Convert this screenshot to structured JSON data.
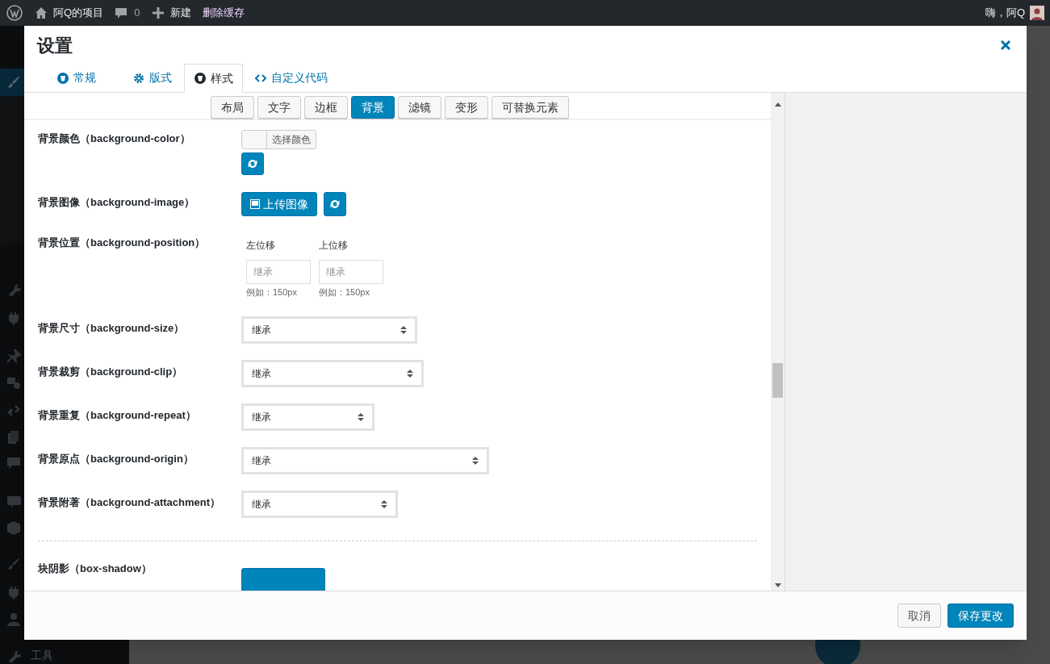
{
  "admin_bar": {
    "site": "阿Q的项目",
    "comments": "0",
    "new": "新建",
    "purge_cache": "删除缓存",
    "greeting": "嗨，阿Q"
  },
  "sidebar": {
    "items": [
      {
        "label": "工具"
      }
    ]
  },
  "modal": {
    "title": "设置",
    "tabs": [
      {
        "label": "常规",
        "selected": false
      },
      {
        "label": "版式",
        "selected": false
      },
      {
        "label": "样式",
        "selected": true
      },
      {
        "label": "自定义代码",
        "selected": false
      }
    ],
    "subtabs": [
      {
        "label": "布局",
        "selected": false
      },
      {
        "label": "文字",
        "selected": false
      },
      {
        "label": "边框",
        "selected": false
      },
      {
        "label": "背景",
        "selected": true
      },
      {
        "label": "滤镜",
        "selected": false
      },
      {
        "label": "变形",
        "selected": false
      },
      {
        "label": "可替换元素",
        "selected": false
      }
    ],
    "fields": [
      {
        "kind": "color",
        "label": "背景颜色（background-color）",
        "button": "选择颜色"
      },
      {
        "kind": "image",
        "label": "背景图像（background-image）",
        "button": "上传图像"
      },
      {
        "kind": "position",
        "label": "背景位置（background-position）",
        "inputs": [
          {
            "label": "左位移",
            "placeholder": "继承",
            "hint": "例如：150px"
          },
          {
            "label": "上位移",
            "placeholder": "继承",
            "hint": "例如：150px"
          }
        ]
      },
      {
        "kind": "select",
        "label": "背景尺寸（background-size）",
        "value": "继承"
      },
      {
        "kind": "select",
        "label": "背景裁剪（background-clip）",
        "value": "继承"
      },
      {
        "kind": "select",
        "label": "背景重复（background-repeat）",
        "value": "继承"
      },
      {
        "kind": "select",
        "label": "背景原点（background-origin）",
        "value": "继承"
      },
      {
        "kind": "select",
        "label": "背景附著（background-attachment）",
        "value": "继承"
      },
      {
        "kind": "divider"
      },
      {
        "kind": "shadow",
        "label": "块阴影（box-shadow）"
      }
    ],
    "footer_buttons": [
      {
        "kind": "secondary",
        "label": "取消"
      },
      {
        "kind": "primary",
        "label": "保存更改"
      }
    ]
  }
}
